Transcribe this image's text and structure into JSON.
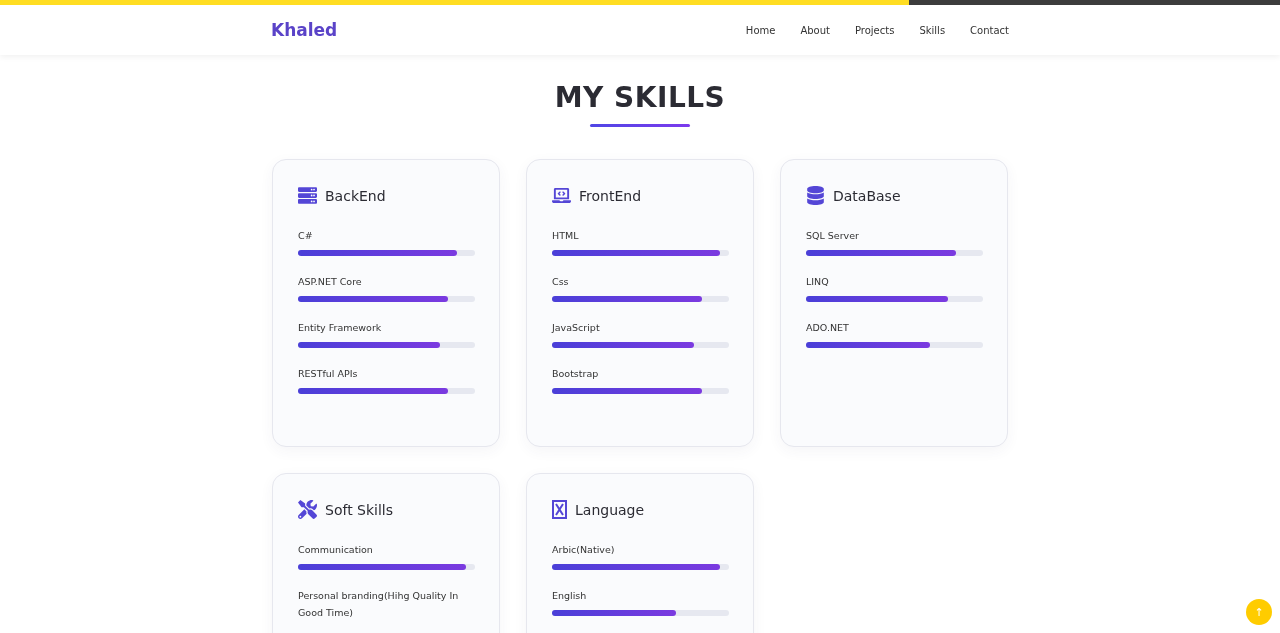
{
  "scroll_progress": {
    "level": 0.71
  },
  "navbar": {
    "brand": "Khaled",
    "links": [
      "Home",
      "About",
      "Projects",
      "Skills",
      "Contact"
    ]
  },
  "section": {
    "title": "MY SKILLS"
  },
  "cards": [
    {
      "kind": "server",
      "title": "BackEnd",
      "skills": [
        {
          "name": "C#",
          "level": 0.9
        },
        {
          "name": "ASP.NET Core",
          "level": 0.85
        },
        {
          "name": "Entity Framework",
          "level": 0.8
        },
        {
          "name": "RESTful APIs",
          "level": 0.85
        }
      ]
    },
    {
      "kind": "laptop",
      "title": "FrontEnd",
      "skills": [
        {
          "name": "HTML",
          "level": 0.95
        },
        {
          "name": "Css",
          "level": 0.85
        },
        {
          "name": "JavaScript",
          "level": 0.8
        },
        {
          "name": "Bootstrap",
          "level": 0.85
        }
      ]
    },
    {
      "kind": "database",
      "title": "DataBase",
      "skills": [
        {
          "name": "SQL Server",
          "level": 0.85
        },
        {
          "name": "LINQ",
          "level": 0.8
        },
        {
          "name": "ADO.NET",
          "level": 0.7
        }
      ]
    },
    {
      "kind": "tools",
      "title": "Soft Skills",
      "skills": [
        {
          "name": "Communication",
          "level": 0.95
        },
        {
          "name": "Personal branding(Hihg Quality In Good Time)"
        }
      ]
    },
    {
      "kind": "language",
      "title": "Language",
      "skills": [
        {
          "name": "Arbic(Native)",
          "level": 0.95
        },
        {
          "name": "English",
          "level": 0.7
        }
      ]
    }
  ],
  "scroll_top_button": {
    "label": "↑"
  }
}
